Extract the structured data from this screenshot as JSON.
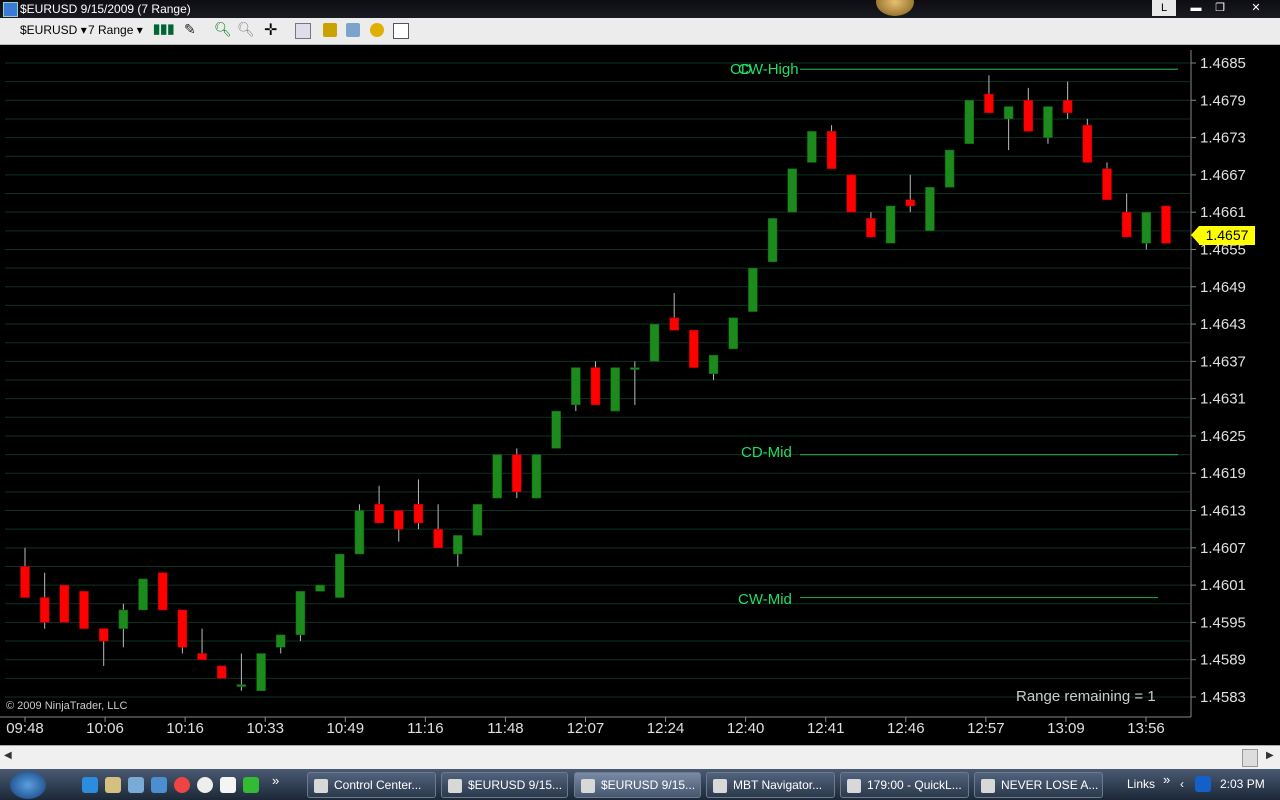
{
  "window": {
    "title": "$EURUSD  9/15/2009 (7 Range)",
    "buttons": {
      "lock": "L",
      "minimize": "▬",
      "restore": "❐",
      "close": "✕"
    }
  },
  "toolbar": {
    "instrument": "$EURUSD",
    "interval": "7 Range",
    "icons": [
      "bar-type-icon",
      "draw-tool-icon",
      "zoom-in-icon",
      "zoom-out-icon",
      "crosshair-icon",
      "properties-icon",
      "indicators-icon",
      "strategies-icon",
      "data-box-icon",
      "chart-trader-icon"
    ]
  },
  "chart": {
    "copyright": "© 2009 NinjaTrader, LLC",
    "range_remaining": "Range remaining = 1",
    "last_price": "1.4657",
    "annotations": {
      "cw_high": "CW-High",
      "cd_high_overlap": "CD",
      "cd_mid": "CD-Mid",
      "cw_mid": "CW-Mid"
    },
    "colors": {
      "up": "#00ff00",
      "down": "#ff0000",
      "up_body": "#1c8a1c",
      "down_body": "#ff0000",
      "grid": "#0d3320",
      "level_green": "#1f9a3e",
      "level_red": "#b02020",
      "level_pink": "#d98bd9",
      "label": "#22dd66",
      "tag": "#ffff00"
    }
  },
  "chart_data": {
    "type": "candlestick",
    "title": "",
    "instrument": "$EURUSD",
    "date": "9/15/2009",
    "bar_type": "7 Range",
    "y_ticks": [
      "1.4685",
      "1.4679",
      "1.4673",
      "1.4667",
      "1.4661",
      "1.4655",
      "1.4649",
      "1.4643",
      "1.4637",
      "1.4631",
      "1.4625",
      "1.4619",
      "1.4613",
      "1.4607",
      "1.4601",
      "1.4595",
      "1.4589",
      "1.4583"
    ],
    "x_ticks": [
      "09:48",
      "10:06",
      "10:16",
      "10:33",
      "10:49",
      "11:16",
      "11:48",
      "12:07",
      "12:24",
      "12:40",
      "12:41",
      "12:46",
      "12:57",
      "13:09",
      "13:56"
    ],
    "ylim": [
      1.458,
      1.4688
    ],
    "bars": [
      {
        "o": 1.4604,
        "h": 1.4607,
        "l": 1.4599,
        "c": 1.4599
      },
      {
        "o": 1.4599,
        "h": 1.4603,
        "l": 1.4594,
        "c": 1.4595
      },
      {
        "o": 1.4601,
        "h": 1.4601,
        "l": 1.4595,
        "c": 1.4595
      },
      {
        "o": 1.46,
        "h": 1.46,
        "l": 1.4594,
        "c": 1.4594
      },
      {
        "o": 1.4594,
        "h": 1.4594,
        "l": 1.4588,
        "c": 1.4592
      },
      {
        "o": 1.4594,
        "h": 1.4598,
        "l": 1.4591,
        "c": 1.4597
      },
      {
        "o": 1.4597,
        "h": 1.4602,
        "l": 1.4597,
        "c": 1.4602
      },
      {
        "o": 1.4603,
        "h": 1.4603,
        "l": 1.4597,
        "c": 1.4597
      },
      {
        "o": 1.4597,
        "h": 1.4597,
        "l": 1.459,
        "c": 1.4591
      },
      {
        "o": 1.459,
        "h": 1.4594,
        "l": 1.4589,
        "c": 1.4589
      },
      {
        "o": 1.4588,
        "h": 1.4588,
        "l": 1.4586,
        "c": 1.4586
      },
      {
        "o": 1.4585,
        "h": 1.459,
        "l": 1.4584,
        "c": 1.4585
      },
      {
        "o": 1.4584,
        "h": 1.459,
        "l": 1.4584,
        "c": 1.459
      },
      {
        "o": 1.4591,
        "h": 1.4593,
        "l": 1.459,
        "c": 1.4593
      },
      {
        "o": 1.4593,
        "h": 1.46,
        "l": 1.4592,
        "c": 1.46
      },
      {
        "o": 1.46,
        "h": 1.4601,
        "l": 1.46,
        "c": 1.4601
      },
      {
        "o": 1.4599,
        "h": 1.4606,
        "l": 1.4599,
        "c": 1.4606
      },
      {
        "o": 1.4606,
        "h": 1.4614,
        "l": 1.4606,
        "c": 1.4613
      },
      {
        "o": 1.4614,
        "h": 1.4617,
        "l": 1.4611,
        "c": 1.4611
      },
      {
        "o": 1.4613,
        "h": 1.4613,
        "l": 1.4608,
        "c": 1.461
      },
      {
        "o": 1.4614,
        "h": 1.4618,
        "l": 1.461,
        "c": 1.4611
      },
      {
        "o": 1.461,
        "h": 1.4614,
        "l": 1.4607,
        "c": 1.4607
      },
      {
        "o": 1.4606,
        "h": 1.4609,
        "l": 1.4604,
        "c": 1.4609
      },
      {
        "o": 1.4609,
        "h": 1.4614,
        "l": 1.4609,
        "c": 1.4614
      },
      {
        "o": 1.4615,
        "h": 1.4622,
        "l": 1.4615,
        "c": 1.4622
      },
      {
        "o": 1.4622,
        "h": 1.4623,
        "l": 1.4615,
        "c": 1.4616
      },
      {
        "o": 1.4615,
        "h": 1.4622,
        "l": 1.4615,
        "c": 1.4622
      },
      {
        "o": 1.4623,
        "h": 1.4629,
        "l": 1.4623,
        "c": 1.4629
      },
      {
        "o": 1.463,
        "h": 1.4636,
        "l": 1.4629,
        "c": 1.4636
      },
      {
        "o": 1.4636,
        "h": 1.4637,
        "l": 1.463,
        "c": 1.463
      },
      {
        "o": 1.4629,
        "h": 1.4636,
        "l": 1.4629,
        "c": 1.4636
      },
      {
        "o": 1.4636,
        "h": 1.4637,
        "l": 1.463,
        "c": 1.4636
      },
      {
        "o": 1.4637,
        "h": 1.4643,
        "l": 1.4637,
        "c": 1.4643
      },
      {
        "o": 1.4644,
        "h": 1.4648,
        "l": 1.4642,
        "c": 1.4642
      },
      {
        "o": 1.4642,
        "h": 1.4642,
        "l": 1.4636,
        "c": 1.4636
      },
      {
        "o": 1.4635,
        "h": 1.4638,
        "l": 1.4634,
        "c": 1.4638
      },
      {
        "o": 1.4639,
        "h": 1.4644,
        "l": 1.4639,
        "c": 1.4644
      },
      {
        "o": 1.4645,
        "h": 1.4652,
        "l": 1.4645,
        "c": 1.4652
      },
      {
        "o": 1.4653,
        "h": 1.466,
        "l": 1.4653,
        "c": 1.466
      },
      {
        "o": 1.4661,
        "h": 1.4668,
        "l": 1.4661,
        "c": 1.4668
      },
      {
        "o": 1.4669,
        "h": 1.4674,
        "l": 1.4669,
        "c": 1.4674
      },
      {
        "o": 1.4674,
        "h": 1.4675,
        "l": 1.4668,
        "c": 1.4668
      },
      {
        "o": 1.4667,
        "h": 1.4667,
        "l": 1.4661,
        "c": 1.4661
      },
      {
        "o": 1.466,
        "h": 1.4661,
        "l": 1.4657,
        "c": 1.4657
      },
      {
        "o": 1.4656,
        "h": 1.4662,
        "l": 1.4656,
        "c": 1.4662
      },
      {
        "o": 1.4663,
        "h": 1.4667,
        "l": 1.4661,
        "c": 1.4662
      },
      {
        "o": 1.4658,
        "h": 1.4665,
        "l": 1.4658,
        "c": 1.4665
      },
      {
        "o": 1.4665,
        "h": 1.4671,
        "l": 1.4665,
        "c": 1.4671
      },
      {
        "o": 1.4672,
        "h": 1.4679,
        "l": 1.4672,
        "c": 1.4679
      },
      {
        "o": 1.468,
        "h": 1.4683,
        "l": 1.4677,
        "c": 1.4677
      },
      {
        "o": 1.4676,
        "h": 1.4678,
        "l": 1.4671,
        "c": 1.4678
      },
      {
        "o": 1.4679,
        "h": 1.4681,
        "l": 1.4674,
        "c": 1.4674
      },
      {
        "o": 1.4673,
        "h": 1.4678,
        "l": 1.4672,
        "c": 1.4678
      },
      {
        "o": 1.4679,
        "h": 1.4682,
        "l": 1.4676,
        "c": 1.4677
      },
      {
        "o": 1.4675,
        "h": 1.4676,
        "l": 1.4669,
        "c": 1.4669
      },
      {
        "o": 1.4668,
        "h": 1.4669,
        "l": 1.4663,
        "c": 1.4663
      },
      {
        "o": 1.4661,
        "h": 1.4664,
        "l": 1.4657,
        "c": 1.4657
      },
      {
        "o": 1.4656,
        "h": 1.4661,
        "l": 1.4655,
        "c": 1.4661
      },
      {
        "o": 1.4662,
        "h": 1.4662,
        "l": 1.4656,
        "c": 1.4656
      }
    ],
    "levels": [
      {
        "name": "CW-High",
        "price": 1.4684,
        "color": "green"
      },
      {
        "name": "CD-Mid",
        "price": 1.4622,
        "color": "green"
      },
      {
        "name": "CW-Mid",
        "price": 1.4599,
        "color": "green"
      }
    ]
  },
  "taskbar": {
    "links": "Links",
    "clock": "2:03 PM",
    "chevron": "»",
    "items": [
      {
        "label": "Control Center...",
        "active": false
      },
      {
        "label": "$EURUSD  9/15...",
        "active": false
      },
      {
        "label": "$EURUSD  9/15...",
        "active": true
      },
      {
        "label": "MBT Navigator...",
        "active": false
      },
      {
        "label": "179:00 - QuickL...",
        "active": false
      },
      {
        "label": "NEVER LOSE A...",
        "active": false
      }
    ]
  }
}
